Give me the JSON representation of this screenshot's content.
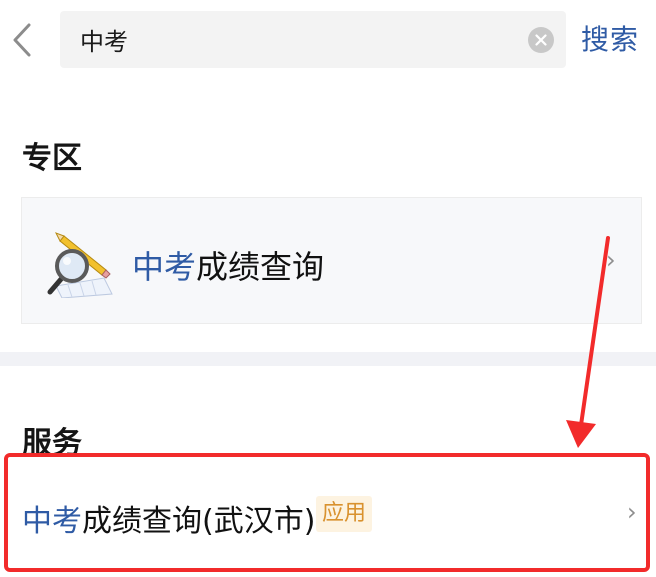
{
  "search": {
    "value": "中考",
    "button_label": "搜索"
  },
  "sections": {
    "zone_title": "专区",
    "service_title": "服务"
  },
  "zone_card": {
    "highlight": "中考",
    "rest": "成绩查询",
    "icon": "magnifier-pencil-icon"
  },
  "service_item": {
    "highlight": "中考",
    "rest": "成绩查询(武汉市)",
    "badge": "应用"
  },
  "icons": {
    "back": "chevron-left-icon",
    "clear": "clear-circle-icon",
    "chevron": "chevron-right-icon"
  },
  "colors": {
    "accent": "#2f5ba5",
    "badge_text": "#d9922f",
    "badge_bg": "#fdf3e1",
    "annotation": "#f22b2b"
  }
}
